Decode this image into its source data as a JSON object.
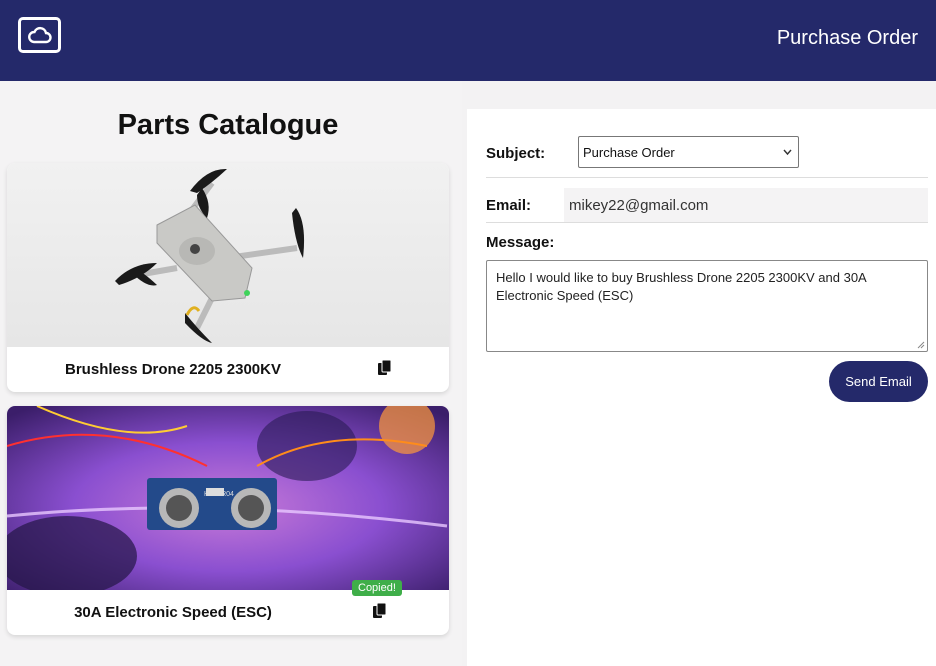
{
  "header": {
    "title": "Purchase Order",
    "logo_icon": "cloud-icon"
  },
  "catalogue": {
    "title": "Parts Catalogue",
    "items": [
      {
        "name": "Brushless Drone 2205 2300KV",
        "image_icon": "drone-photo",
        "copy_icon": "copy-icon"
      },
      {
        "name": "30A Electronic Speed (ESC)",
        "image_icon": "ultrasonic-sensor-photo",
        "copy_icon": "copy-icon",
        "badge": "Copied!",
        "image_label": "HC-SR04"
      }
    ]
  },
  "form": {
    "subject_label": "Subject:",
    "subject_value": "Purchase Order",
    "email_label": "Email:",
    "email_value": "mikey22@gmail.com",
    "message_label": "Message:",
    "message_value": "Hello I would like to buy Brushless Drone 2205 2300KV and 30A Electronic Speed (ESC)",
    "send_label": "Send Email"
  },
  "colors": {
    "navy": "#24296a",
    "badge_green": "#3fae49",
    "page_bg": "#f4f3f4"
  }
}
